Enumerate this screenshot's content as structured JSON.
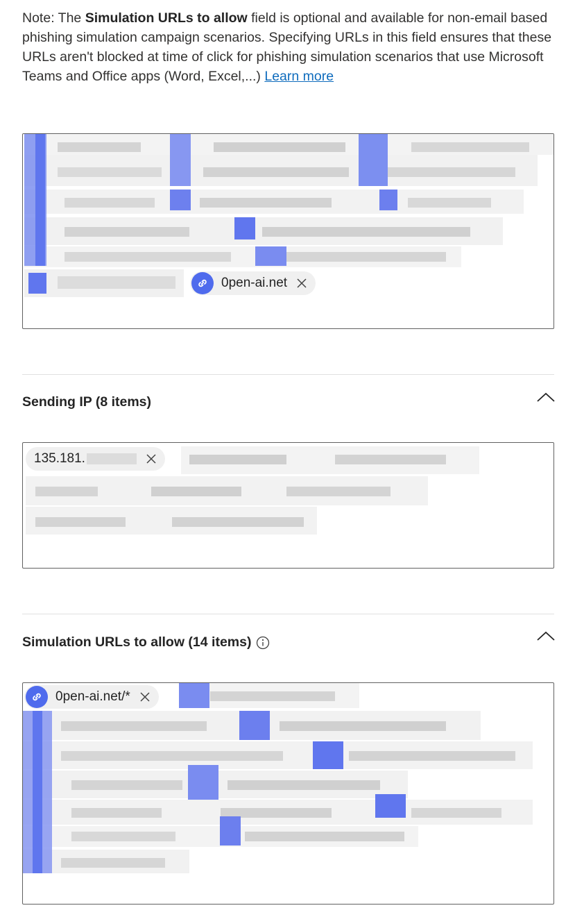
{
  "note": {
    "prefix": "Note: The ",
    "bold": "Simulation URLs to allow",
    "suffix": " field is optional and available for non-email based phishing simulation campaign scenarios. Specifying URLs in this field ensures that these URLs aren't blocked at time of click for phishing simulation scenarios that use Microsoft Teams and Office apps (Word, Excel,...) ",
    "link": "Learn more"
  },
  "domains_field": {
    "visible_pill": "0pen-ai.net"
  },
  "sending_ip": {
    "title": "Sending IP (8 items)",
    "visible_pill": "135.181."
  },
  "simulation_urls": {
    "title": "Simulation URLs to allow (14 items)",
    "visible_pill": "0pen-ai.net/*"
  },
  "colors": {
    "accent": "#4f6bed",
    "link": "#0f6cbd",
    "pill_bg": "#f0f0f0",
    "border": "#616161"
  },
  "icons": {
    "link": "link-icon",
    "remove": "dismiss-icon",
    "collapse": "chevron-up-icon",
    "info": "info-icon"
  }
}
